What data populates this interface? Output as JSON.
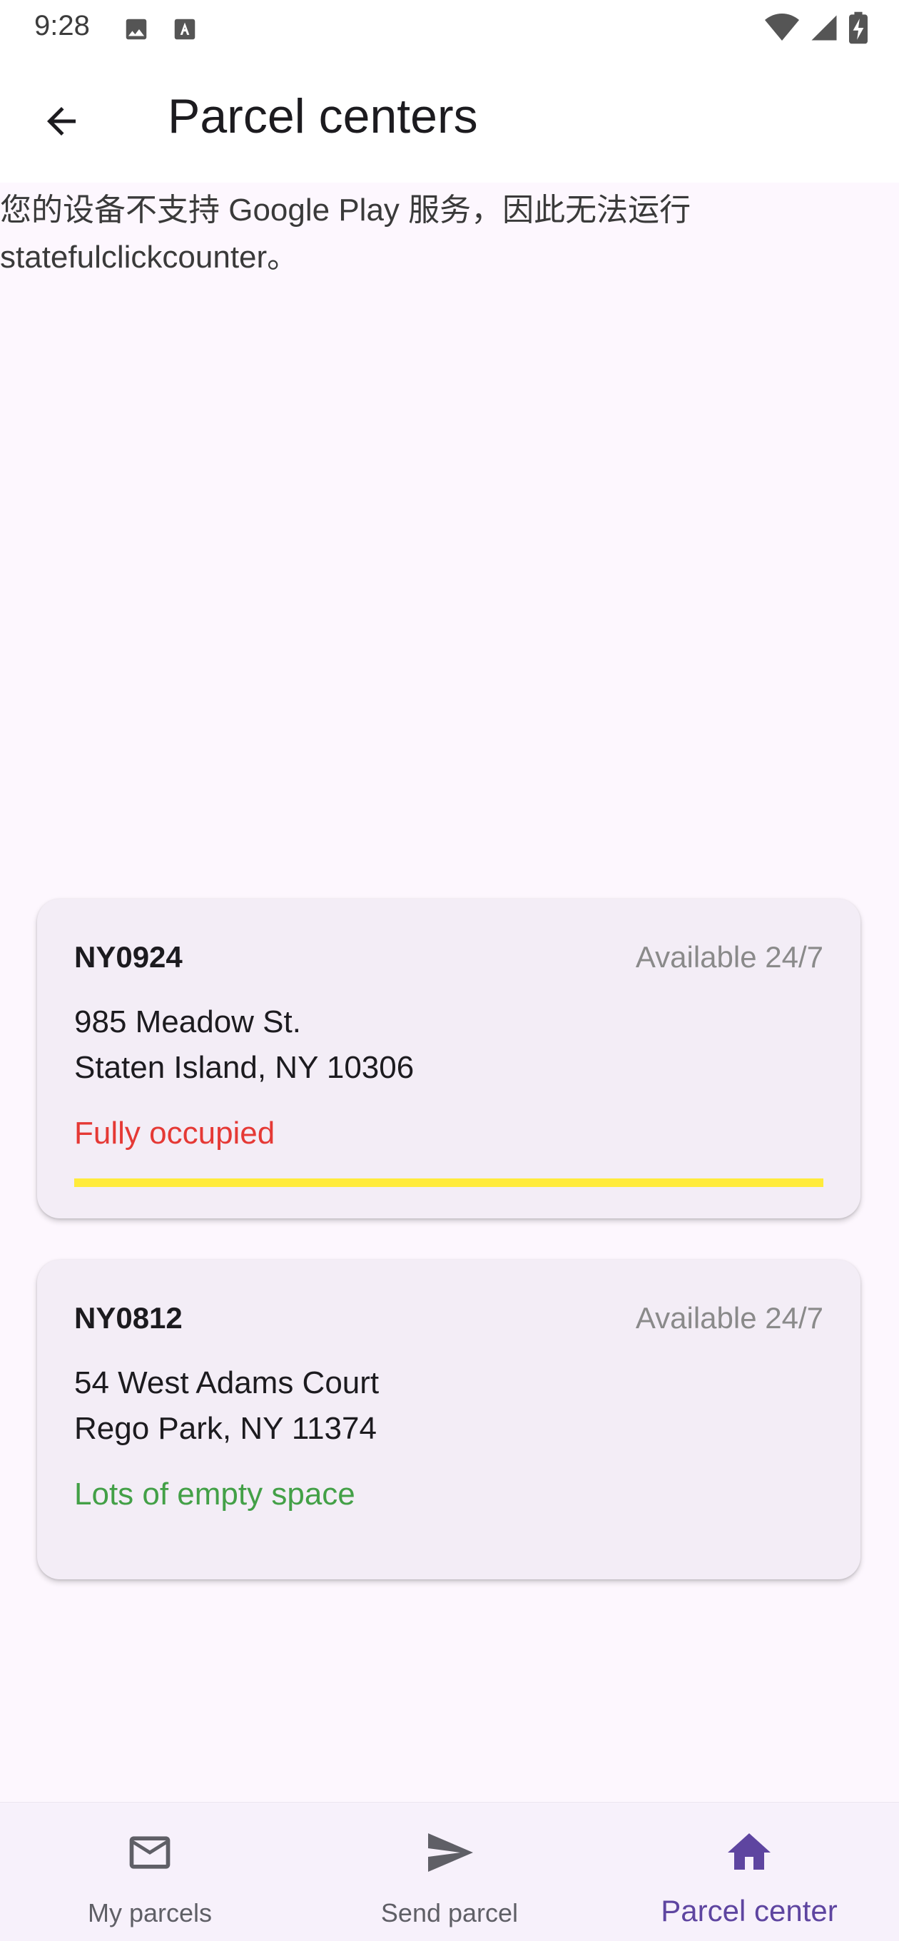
{
  "status_bar": {
    "time": "9:28",
    "icons_left": [
      "image-icon",
      "keyboard-a-icon"
    ],
    "icons_right": [
      "wifi-icon",
      "signal-icon",
      "battery-charging-icon"
    ]
  },
  "app_bar": {
    "back_icon": "arrow-back-icon",
    "title": "Parcel centers"
  },
  "gms_error": {
    "line1": "您的设备不支持 Google Play 服务，因此无法运行",
    "line2": "statefulclickcounter。"
  },
  "parcel_centers": [
    {
      "id": "NY0924",
      "availability": "Available 24/7",
      "address_line1": "985 Meadow St.",
      "address_line2": "Staten Island, NY 10306",
      "status": "Fully occupied",
      "status_color": "#e53935",
      "occupancy_percent": 100,
      "progress_color": "#ffeb3b"
    },
    {
      "id": "NY0812",
      "availability": "Available 24/7",
      "address_line1": "54 West Adams Court",
      "address_line2": "Rego Park, NY 11374",
      "status": "Lots of empty space",
      "status_color": "#43a047"
    }
  ],
  "bottom_nav": {
    "items": [
      {
        "label": "My parcels",
        "icon": "mail-icon",
        "selected": false
      },
      {
        "label": "Send parcel",
        "icon": "send-icon",
        "selected": false
      },
      {
        "label": "Parcel center",
        "icon": "home-icon",
        "selected": true
      }
    ],
    "selected_color": "#5e45a0"
  }
}
